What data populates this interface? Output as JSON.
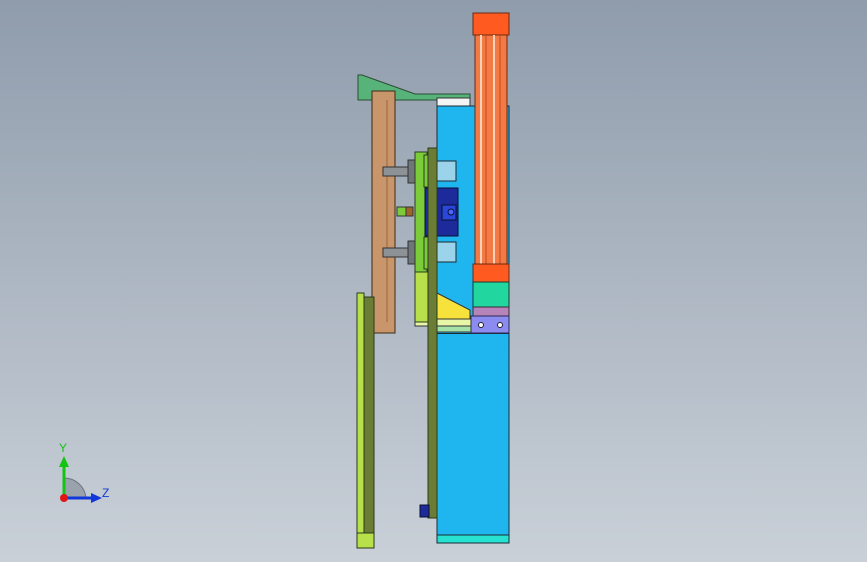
{
  "viewport": {
    "background_top": "#8f9cac",
    "background_bottom": "#c9d0d8"
  },
  "model": {
    "colors": {
      "cylinder_barrel": "#f47a45",
      "cylinder_rod_cap": "#ff5a1f",
      "main_body": "#1fb6f0",
      "base_plate": "#27e2d0",
      "mount_block": "#22d6a0",
      "flange": "#b684b8",
      "bracket": "#8c8cf0",
      "wood_arm": "#c8966a",
      "guide_plate_dark": "#6b7d34",
      "guide_plate_light": "#b7e04a",
      "green_slide": "#7ccc3a",
      "yellow_wedge": "#f6e23a",
      "top_wedge": "#58b37a",
      "blue_block": "#1d2a9a",
      "shaft": "#8c9296",
      "bushing": "#9ad3ea"
    }
  },
  "triad": {
    "y_label": "Y",
    "z_label": "Z",
    "y_color": "#13c413",
    "z_color": "#1238d8",
    "x_color": "#e01515"
  }
}
